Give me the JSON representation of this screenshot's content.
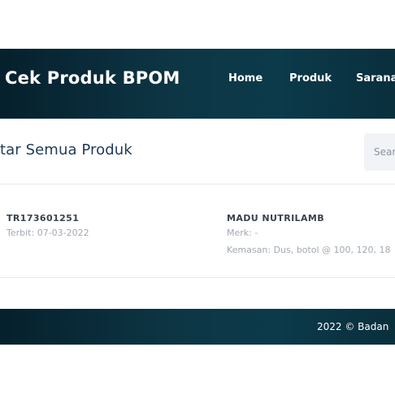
{
  "header": {
    "brand": "Cek Produk BPOM",
    "nav": {
      "home": "Home",
      "produk": "Produk",
      "sarana": "Sarana"
    }
  },
  "main": {
    "title": "tar Semua Produk",
    "search_placeholder": "Search"
  },
  "products": [
    {
      "registration_number": "TR173601251",
      "issued": "Terbit: 07-03-2022",
      "name": "MADU NUTRILAMB",
      "merk": "Merk: -",
      "packaging": "Kemasan: Dus, botol @ 100, 120, 18"
    }
  ],
  "footer": {
    "text": "2022 ©  Badan"
  },
  "colors": {
    "header_bg": "#0b3a4a",
    "title_text": "#1f3a5a",
    "muted_text": "#a2a8b2",
    "search_bg": "#f2f3f6"
  }
}
